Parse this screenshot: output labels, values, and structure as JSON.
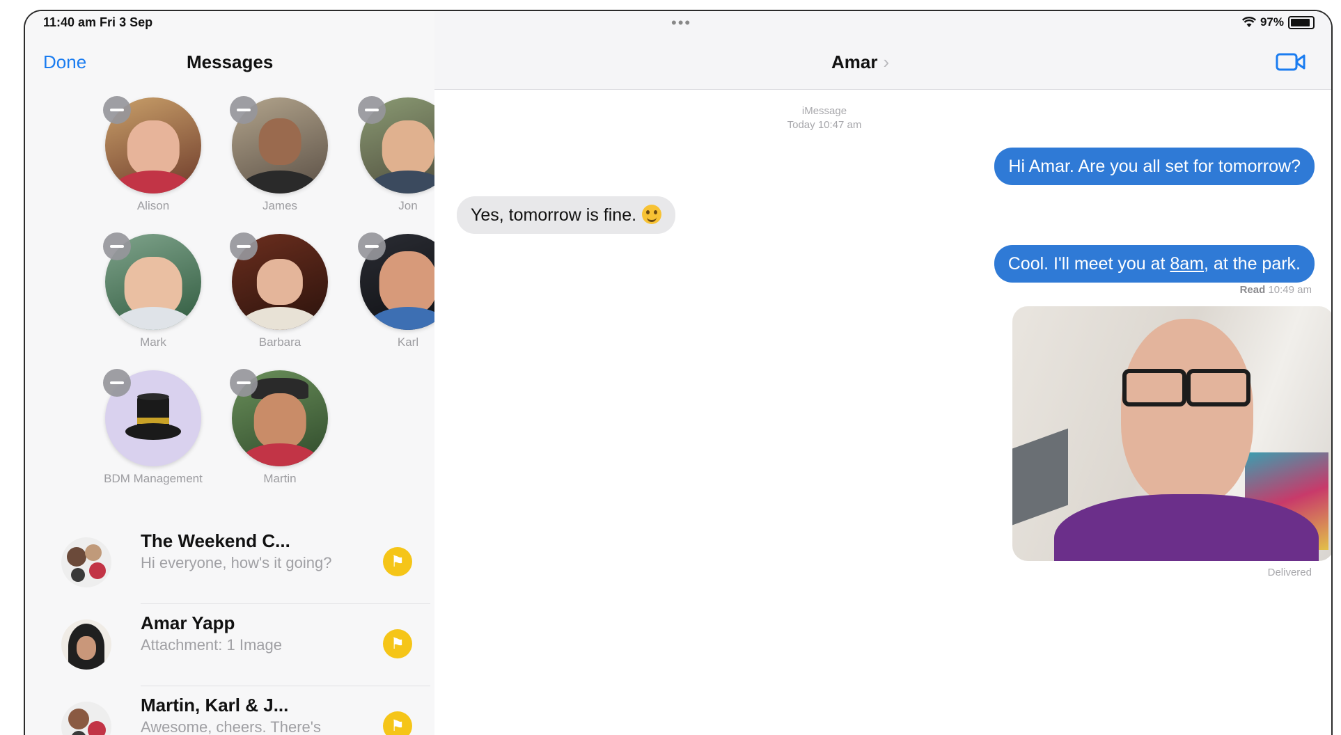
{
  "status": {
    "time": "11:40 am  Fri 3 Sep",
    "battery": "97%"
  },
  "left": {
    "done_label": "Done",
    "title": "Messages",
    "pins": [
      {
        "name": "Alison"
      },
      {
        "name": "James"
      },
      {
        "name": "Jon"
      },
      {
        "name": "Mark"
      },
      {
        "name": "Barbara"
      },
      {
        "name": "Karl"
      },
      {
        "name": "BDM Management"
      },
      {
        "name": "Martin"
      }
    ],
    "conversations": [
      {
        "name": "The Weekend C...",
        "preview": "Hi everyone, how's it going?"
      },
      {
        "name": "Amar Yapp",
        "preview": "Attachment: 1 Image"
      },
      {
        "name": "Martin, Karl & J...",
        "preview": "Awesome, cheers. There's"
      }
    ]
  },
  "chat": {
    "dots": "•••",
    "contact": "Amar",
    "chevron": "›",
    "service": "iMessage",
    "timestamp": "Today 10:47 am",
    "msg1": "Hi Amar. Are you all set for tomorrow?",
    "msg2": "Yes, tomorrow is fine.",
    "msg3_a": "Cool. I'll meet you at ",
    "msg3_link": "8am",
    "msg3_b": ", at the park.",
    "read_label": "Read",
    "read_time": "10:49 am",
    "delivered": "Delivered"
  },
  "colors": {
    "accent": "#1a7cf0",
    "bubble_out": "#2f7ad6",
    "pin_badge": "#f5c518"
  }
}
